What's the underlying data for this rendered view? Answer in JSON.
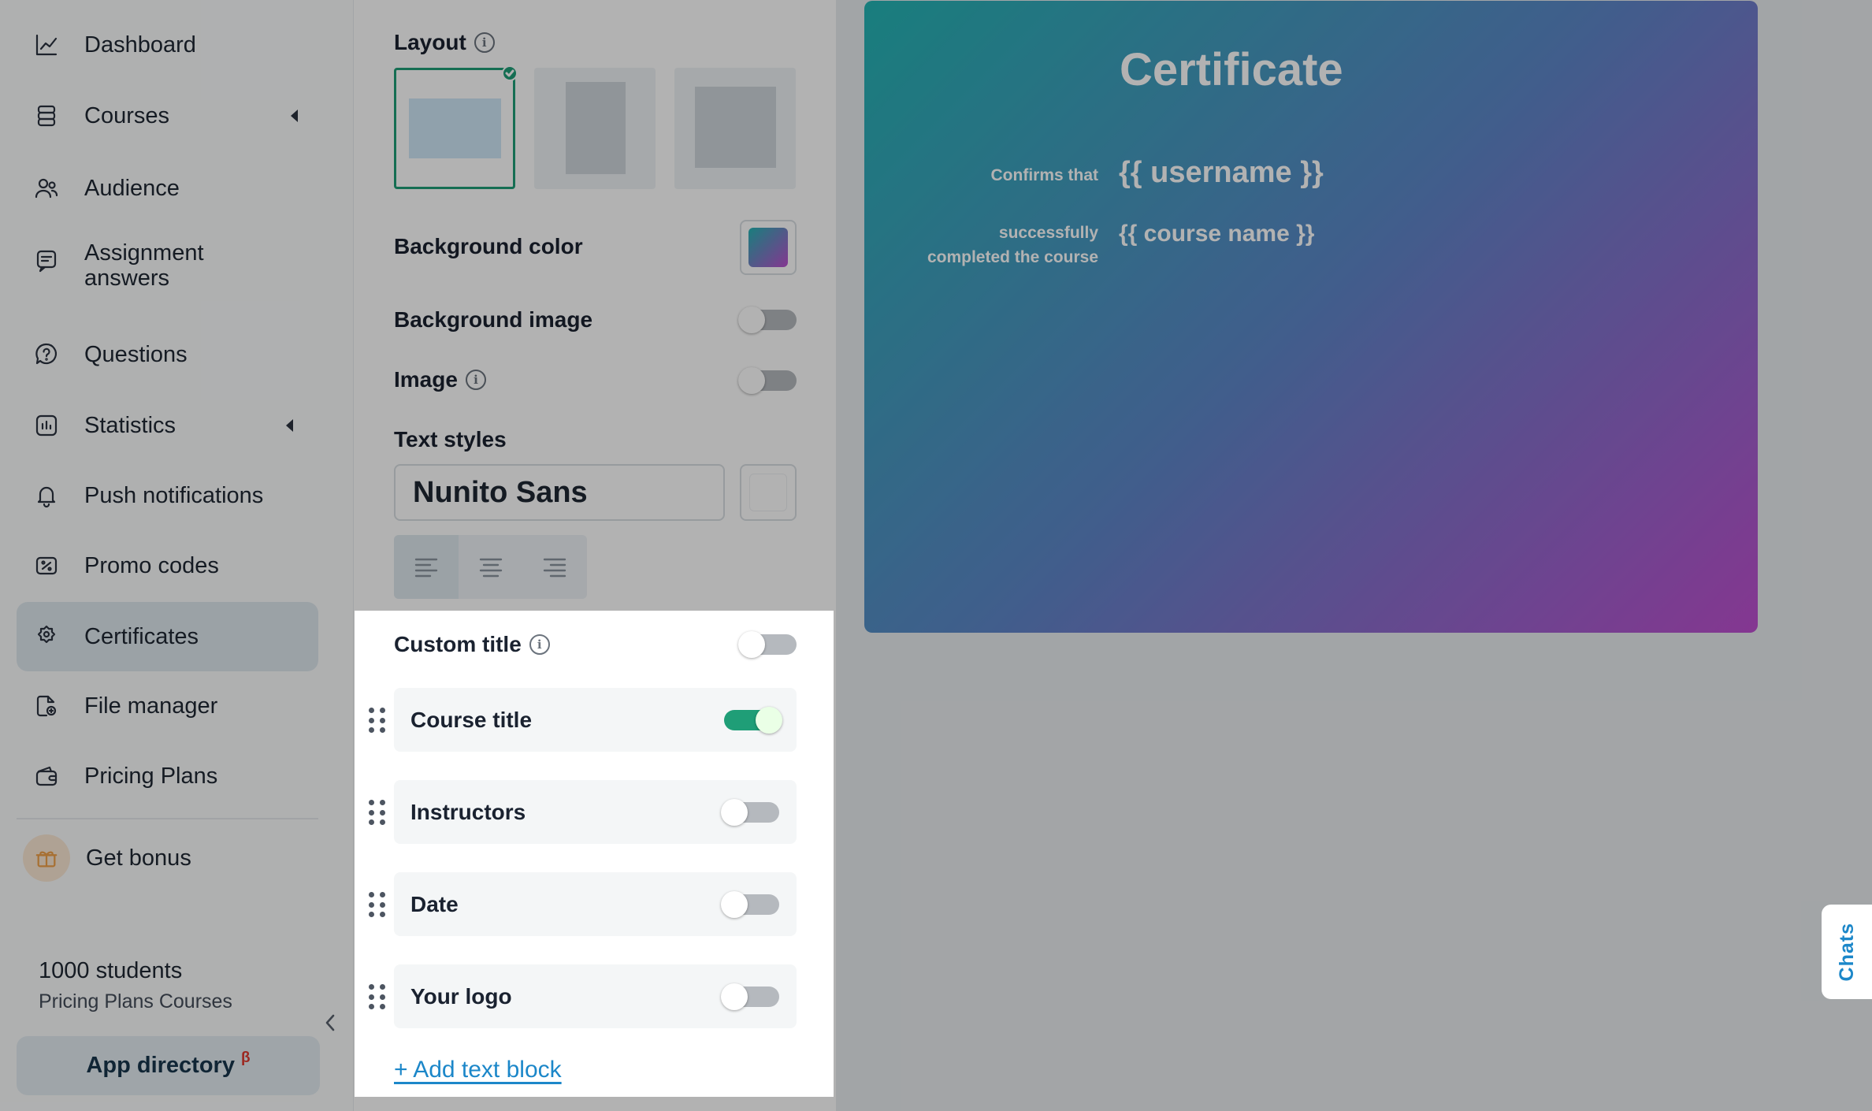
{
  "sidebar": {
    "items": [
      {
        "label": "Dashboard",
        "icon": "chart-line-icon"
      },
      {
        "label": "Courses",
        "icon": "stack-icon"
      },
      {
        "label": "Audience",
        "icon": "users-icon"
      },
      {
        "label": "Assignment answers",
        "icon": "message-icon"
      },
      {
        "label": "Questions",
        "icon": "question-icon"
      },
      {
        "label": "Statistics",
        "icon": "stats-icon"
      },
      {
        "label": "Push notifications",
        "icon": "bell-icon"
      },
      {
        "label": "Promo codes",
        "icon": "ticket-icon"
      },
      {
        "label": "Certificates",
        "icon": "badge-icon"
      },
      {
        "label": "File manager",
        "icon": "file-icon"
      },
      {
        "label": "Pricing Plans",
        "icon": "wallet-icon"
      }
    ],
    "bonus_label": "Get bonus",
    "students_count": "1000 students",
    "students_plan": "Pricing Plans Courses",
    "app_directory_label": "App directory",
    "app_directory_badge": "β"
  },
  "settings": {
    "layout_label": "Layout",
    "background_color_label": "Background color",
    "background_color_value": "gradient #24b5b4 → #be4fd0",
    "background_image_label": "Background image",
    "image_label": "Image",
    "text_styles_label": "Text styles",
    "font_value": "Nunito Sans",
    "font_color": "#ffffff",
    "custom_title_label": "Custom title",
    "blocks": [
      {
        "label": "Course title",
        "enabled": true
      },
      {
        "label": "Instructors",
        "enabled": false
      },
      {
        "label": "Date",
        "enabled": false
      },
      {
        "label": "Your logo",
        "enabled": false
      }
    ],
    "add_block_label": "+ Add text block"
  },
  "certificate": {
    "title": "Certificate",
    "confirms_label": "Confirms that",
    "username_placeholder": "{{ username }}",
    "completed_label_1": "successfully",
    "completed_label_2": "completed the course",
    "course_placeholder": "{{ course name }}"
  },
  "chats_label": "Chats",
  "colors": {
    "accent": "#1f9e77",
    "link": "#1c87c9",
    "active_nav": "#dfe8ee",
    "beta": "#e0392d"
  }
}
